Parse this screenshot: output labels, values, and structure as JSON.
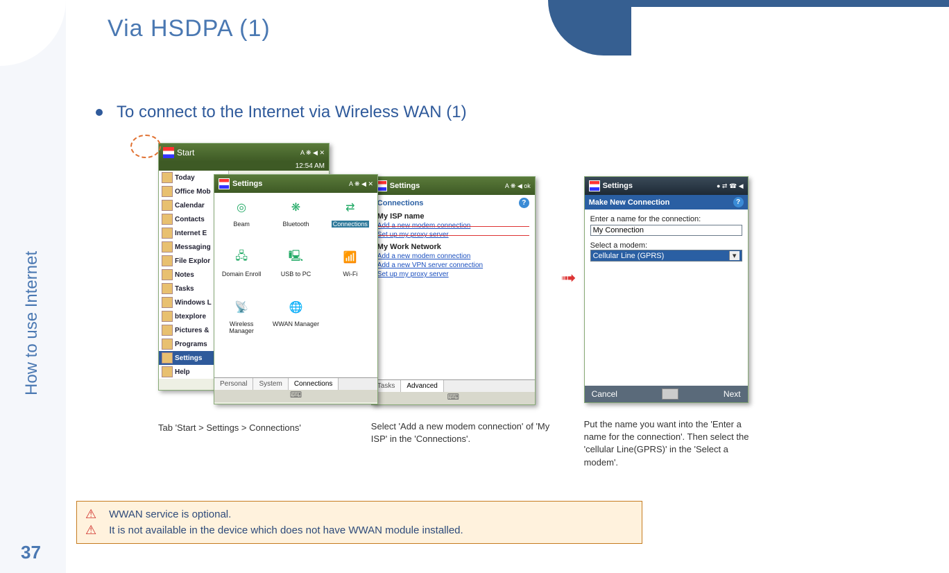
{
  "page": {
    "number": "37",
    "side_label": "How to use Internet",
    "title": "Via HSDPA (1)"
  },
  "bullet": {
    "text": "To connect to the Internet via Wireless WAN (1)"
  },
  "arrow_glyph": "➟",
  "screenshot1": {
    "start_bar_label": "Start",
    "status_icons": "A  ❋  ◀ ✕",
    "clock": "12:54 AM",
    "start_menu": [
      "Today",
      "Office Mob",
      "Calendar",
      "Contacts",
      "Internet E",
      "Messaging",
      "File Explor",
      "Notes",
      "Tasks",
      "Windows L",
      "btexplore",
      "Pictures &",
      "Programs",
      "Settings",
      "Help"
    ],
    "selected_start_item": "Settings",
    "settings_title": "Settings",
    "settings_status": "A  ❋  ◀ ✕",
    "icons": [
      {
        "label": "Beam",
        "glyph": "◎"
      },
      {
        "label": "Bluetooth",
        "glyph": "❋"
      },
      {
        "label": "Connections",
        "glyph": "⇄",
        "highlight": true
      },
      {
        "label": "Domain Enroll",
        "glyph": "🖧"
      },
      {
        "label": "USB to PC",
        "glyph": "🖳"
      },
      {
        "label": "Wi-Fi",
        "glyph": "📶"
      },
      {
        "label": "Wireless Manager",
        "glyph": "📡"
      },
      {
        "label": "WWAN Manager",
        "glyph": "🌐"
      }
    ],
    "tabs": [
      "Personal",
      "System",
      "Connections"
    ],
    "active_tab": "Connections",
    "caption": "Tab 'Start > Settings > Connections'"
  },
  "screenshot2": {
    "title": "Settings",
    "status": "A  ❋  ◀  ok",
    "header": "Connections",
    "group1": "My ISP name",
    "g1_links": [
      "Add a new modem connection",
      "Set up my proxy server"
    ],
    "group2": "My Work Network",
    "g2_links": [
      "Add a new modem connection",
      "Add a new VPN server connection",
      "Set up my proxy server"
    ],
    "tabs": [
      "Tasks",
      "Advanced"
    ],
    "active_tab": "Advanced",
    "caption": "Select 'Add a new modem connection' of 'My ISP' in the 'Connections'."
  },
  "screenshot3": {
    "title": "Settings",
    "status": "● ⇄ ☎ ◀",
    "blue_header": "Make New Connection",
    "label_name": "Enter a name for the connection:",
    "input_value": "My Connection",
    "label_modem": "Select a modem:",
    "selected_modem": "Cellular Line (GPRS)",
    "footer_cancel": "Cancel",
    "footer_next": "Next",
    "caption": "Put the name you want into the 'Enter a name for the connection'. Then select the 'cellular Line(GPRS)' in the 'Select a modem'."
  },
  "warnings": [
    "WWAN service is optional.",
    "It is not available in the device which does not have WWAN module installed."
  ]
}
